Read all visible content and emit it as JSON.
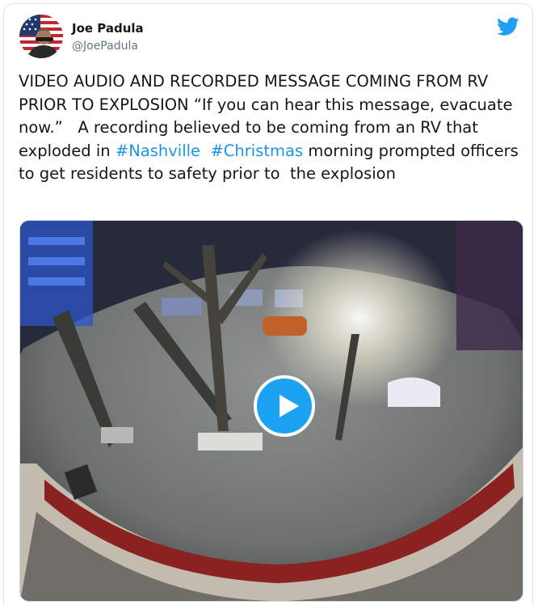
{
  "author": {
    "name": "Joe Padula",
    "handle": "@JoePadula"
  },
  "tweet": {
    "text_1": "VIDEO AUDIO AND RECORDED MESSAGE COMING FROM RV PRIOR TO EXPLOSION “If you can hear this message, evacuate now.”   A recording believed to be coming from an RV that exploded in ",
    "hashtag_1": "#Nashville",
    "text_2": "  ",
    "hashtag_2": "#Christmas",
    "text_3": " morning prompted officers to get residents to safety prior to  the explosion"
  },
  "icons": {
    "logo": "twitter-bird-icon",
    "play": "play-icon"
  },
  "colors": {
    "brand": "#1da1f2",
    "hashtag": "#1b95e0",
    "handle": "#657786"
  }
}
